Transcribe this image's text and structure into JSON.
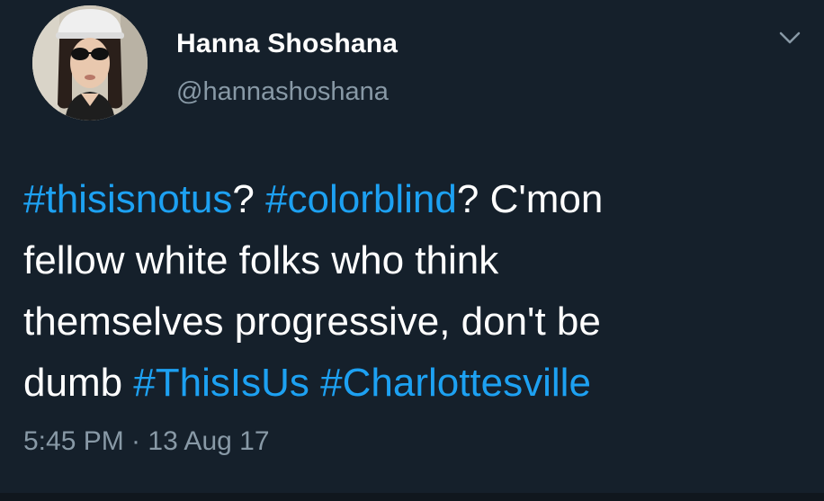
{
  "author": {
    "display_name": "Hanna Shoshana",
    "handle": "@hannashoshana"
  },
  "tweet": {
    "lines": [
      [
        {
          "text": "#thisisnotus",
          "type": "hashtag"
        },
        {
          "text": "? ",
          "type": "text"
        },
        {
          "text": "#colorblind",
          "type": "hashtag"
        },
        {
          "text": "? C'mon",
          "type": "text"
        }
      ],
      [
        {
          "text": "fellow white folks who think",
          "type": "text"
        }
      ],
      [
        {
          "text": "themselves progressive, don't be",
          "type": "text"
        }
      ],
      [
        {
          "text": "dumb ",
          "type": "text"
        },
        {
          "text": "#ThisIsUs",
          "type": "hashtag"
        },
        {
          "text": " ",
          "type": "text"
        },
        {
          "text": "#Charlottesville",
          "type": "hashtag"
        }
      ]
    ],
    "timestamp": "5:45 PM · 13 Aug 17"
  },
  "icons": {
    "more_menu": "chevron-down-icon",
    "avatar": "avatar-photo"
  },
  "colors": {
    "background": "#15202b",
    "primary_text": "#ffffff",
    "secondary_text": "#8899a6",
    "link": "#1da1f2"
  }
}
